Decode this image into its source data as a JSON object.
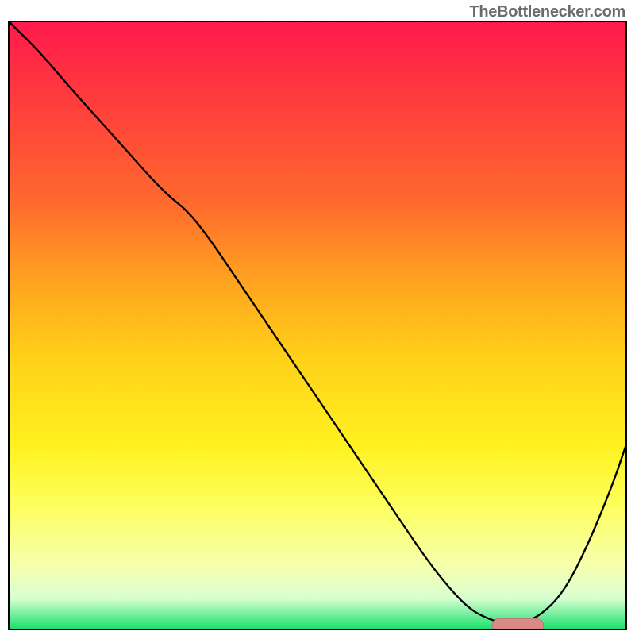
{
  "source_label": "TheBottlenecker.com",
  "gradient_colors": {
    "top": "#ff1a4d",
    "mid_high": "#ffa020",
    "mid": "#fff220",
    "mid_low": "#f5ffb0",
    "bottom": "#1de070"
  },
  "chart_data": {
    "type": "line",
    "title": "",
    "xlabel": "",
    "ylabel": "",
    "xlim": [
      0,
      100
    ],
    "ylim": [
      0,
      100
    ],
    "grid": false,
    "legend": false,
    "series": [
      {
        "name": "bottleneck-curve",
        "color": "#000000",
        "x": [
          0,
          5,
          10,
          18,
          25,
          30,
          38,
          46,
          54,
          62,
          68,
          72,
          75,
          78,
          80,
          83,
          86,
          90,
          94,
          98,
          100
        ],
        "values": [
          100,
          95,
          89,
          80,
          72,
          68,
          56,
          44,
          32,
          20,
          11,
          6,
          3,
          1.5,
          1,
          1,
          2,
          6,
          14,
          24,
          30
        ]
      }
    ],
    "optimum_marker": {
      "x_start": 78,
      "x_end": 86,
      "y": 1,
      "color": "#d98a87"
    }
  }
}
